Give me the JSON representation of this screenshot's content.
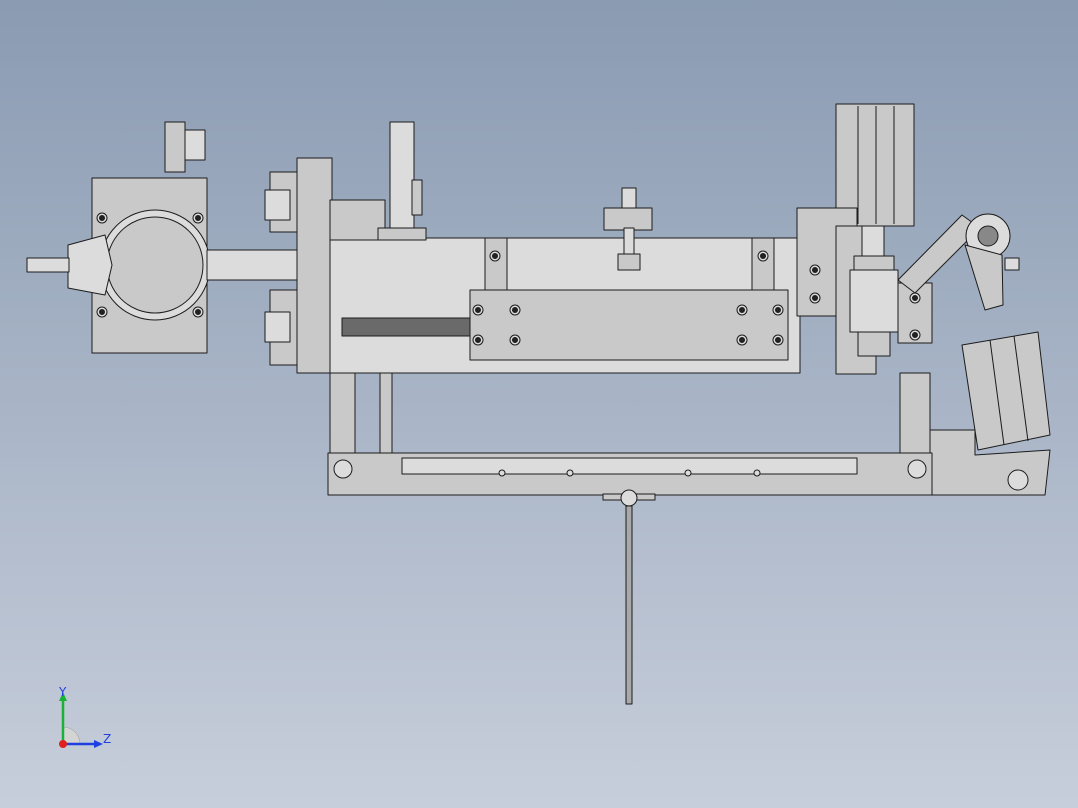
{
  "viewport": {
    "background_top": "#8a9bb2",
    "background_bottom": "#c7cedb"
  },
  "model": {
    "part_fill": "#c9c9c9",
    "part_fill_light": "#dcdcdc",
    "part_fill_dark": "#a9a9a9",
    "edge_color": "#1c1c1c"
  },
  "triad": {
    "y_label": "Y",
    "z_label": "Z",
    "x_color": "#e0201f",
    "y_color": "#19b234",
    "z_color": "#1f3fe0"
  }
}
